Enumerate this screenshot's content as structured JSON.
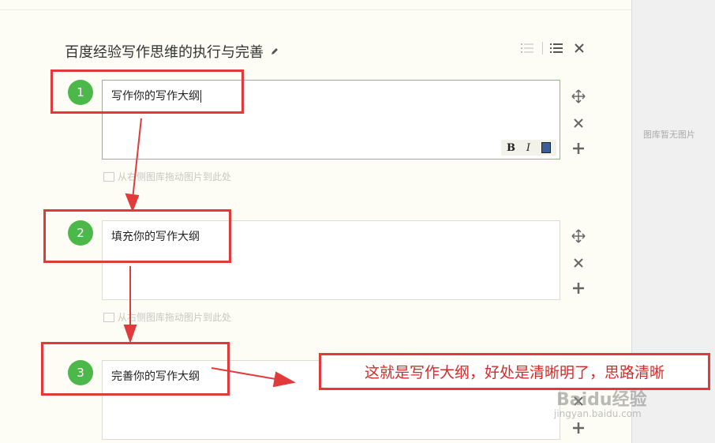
{
  "editor": {
    "title": "百度经验写作思维的执行与完善",
    "icons": [
      "edit-pencil-icon",
      "ordered-list-icon",
      "list-icon",
      "close-icon"
    ]
  },
  "steps": [
    {
      "number": "1",
      "text": "写作你的写作大纲",
      "active": true
    },
    {
      "number": "2",
      "text": "填充你的写作大纲",
      "active": false
    },
    {
      "number": "3",
      "text": "完善你的写作大纲",
      "active": false
    }
  ],
  "format_toolbar": {
    "bold": "B",
    "italic": "I"
  },
  "drop_hint": "从右侧图库拖动图片到此处",
  "sidebar": {
    "empty_text": "图库暂无图片"
  },
  "annotation": {
    "callout": "这就是写作大纲，好处是清晰明了，思路清晰",
    "color": "#e23a3a"
  },
  "watermark": {
    "brand": "Baidu经验",
    "url": "jingyan.baidu.com"
  },
  "colors": {
    "step_badge": "#4cb849",
    "active_border": "#7dc76b"
  }
}
